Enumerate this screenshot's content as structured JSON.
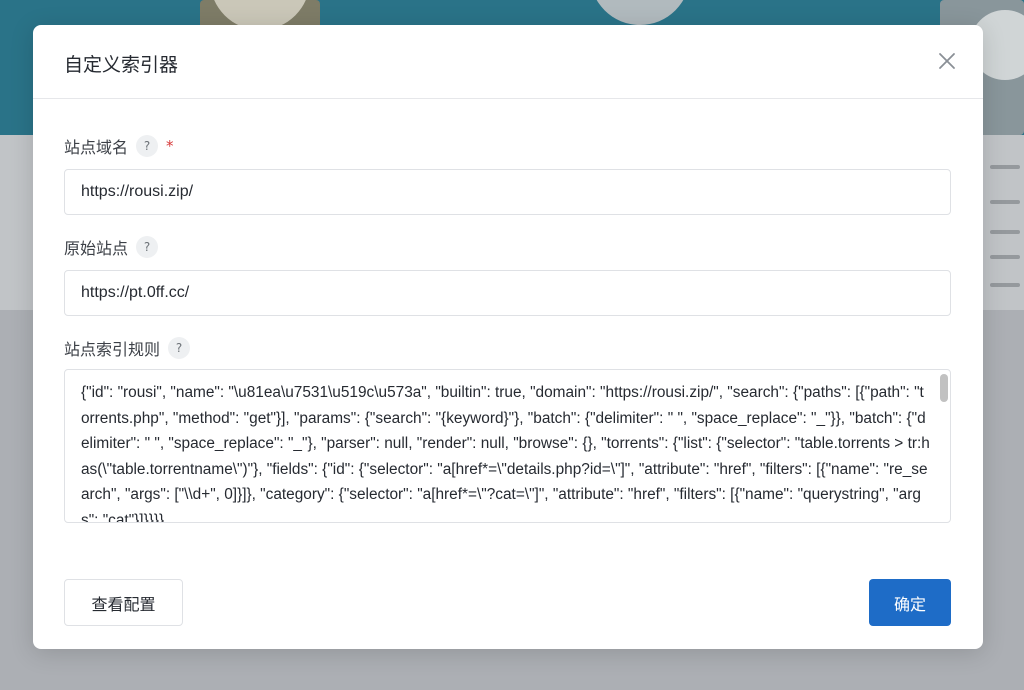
{
  "dialog": {
    "title": "自定义索引器",
    "close_icon": "close-icon"
  },
  "fields": {
    "domain": {
      "label": "站点域名",
      "help": "?",
      "required_mark": "*",
      "value": "https://rousi.zip/"
    },
    "origin": {
      "label": "原始站点",
      "help": "?",
      "value": "https://pt.0ff.cc/"
    },
    "rules": {
      "label": "站点索引规则",
      "help": "?",
      "value": "{\"id\": \"rousi\", \"name\": \"\\u81ea\\u7531\\u519c\\u573a\", \"builtin\": true, \"domain\": \"https://rousi.zip/\", \"search\": {\"paths\": [{\"path\": \"torrents.php\", \"method\": \"get\"}], \"params\": {\"search\": \"{keyword}\"}, \"batch\": {\"delimiter\": \" \", \"space_replace\": \"_\"}}, \"batch\": {\"delimiter\": \" \", \"space_replace\": \"_\"}, \"parser\": null, \"render\": null, \"browse\": {}, \"torrents\": {\"list\": {\"selector\": \"table.torrents > tr:has(\\\"table.torrentname\\\")\"}, \"fields\": {\"id\": {\"selector\": \"a[href*=\\\"details.php?id=\\\"]\", \"attribute\": \"href\", \"filters\": [{\"name\": \"re_search\", \"args\": [\"\\\\d+\", 0]}]}, \"category\": {\"selector\": \"a[href*=\\\"?cat=\\\"]\", \"attribute\": \"href\", \"filters\": [{\"name\": \"querystring\", \"args\": \"cat\"}]}}}}"
    }
  },
  "buttons": {
    "view_config": "查看配置",
    "confirm": "确定"
  },
  "colors": {
    "primary": "#1e6cc7",
    "required": "#d63939"
  }
}
